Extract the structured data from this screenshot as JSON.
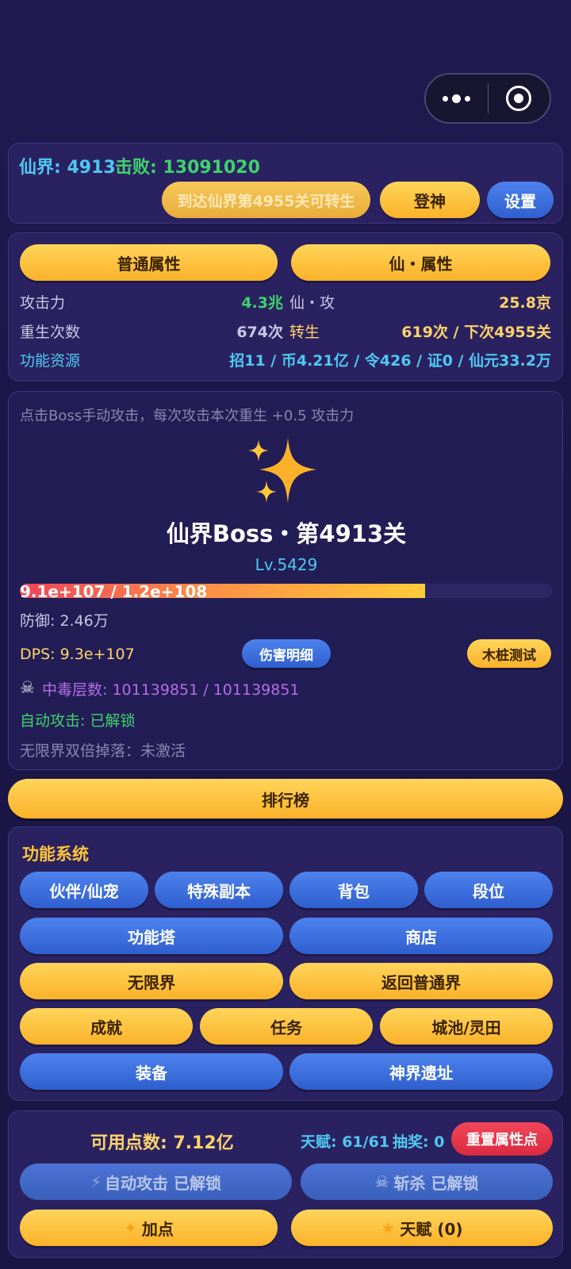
{
  "top": {
    "realm_label": "仙界: 4913",
    "defeat_label": "击败: 13091020",
    "rebirth_hint_button": "到达仙界第4955关可转生",
    "ascend_button": "登神",
    "settings_button": "设置"
  },
  "attributes": {
    "tab_normal": "普通属性",
    "tab_xian": "仙・属性",
    "rows": [
      {
        "left_label": "攻击力",
        "left_value": "4.3兆",
        "right_label": "仙・攻",
        "right_value": "25.8京"
      },
      {
        "left_label": "重生次数",
        "left_value": "674次",
        "right_label": "转生",
        "right_value": "619次 / 下次4955关"
      }
    ],
    "resources_label": "功能资源",
    "resources_value": "招11 / 币4.21亿 / 令426 / 证0 / 仙元33.2万"
  },
  "boss": {
    "hint": "点击Boss手动攻击，每次攻击本次重生 +0.5 攻击力",
    "icon": "sparkles-icon",
    "name": "仙界Boss・第4913关",
    "level": "Lv.5429",
    "hp_text": "9.1e+107 / 1.2e+108",
    "hp_fraction": 0.76,
    "defense": "防御: 2.46万",
    "dps": "DPS: 9.3e+107",
    "damage_detail_button": "伤害明细",
    "dummy_test_button": "木桩测试",
    "poison": "中毒层数: 101139851 / 101139851",
    "auto_attack": "自动攻击: 已解锁",
    "double_drop": "无限界双倍掉落：未激活"
  },
  "leaderboard_button": "排行榜",
  "features": {
    "title": "功能系统",
    "row1": [
      "伙伴/仙宠",
      "特殊副本",
      "背包",
      "段位"
    ],
    "row2": [
      "功能塔",
      "商店"
    ],
    "row3": [
      "无限界",
      "返回普通界"
    ],
    "row4": [
      "成就",
      "任务",
      "城池/灵田"
    ],
    "row5": [
      "装备",
      "神界遗址"
    ]
  },
  "points": {
    "available": "可用点数: 7.12亿",
    "talent": "天赋: 61/61",
    "lottery": "抽奖: 0",
    "reset_button": "重置属性点",
    "auto_attack_button": "自动攻击 已解锁",
    "slay_button": "斩杀 已解锁",
    "add_point_button": "加点",
    "talent_button": "天赋 (0)"
  },
  "colors": {
    "gold": "#fbb22a",
    "blue": "#2f5fce",
    "green": "#3ed36b",
    "cyan": "#4fc8f0",
    "orange_text": "#ffd36b",
    "purple": "#b36de6",
    "red": "#e0344c"
  }
}
